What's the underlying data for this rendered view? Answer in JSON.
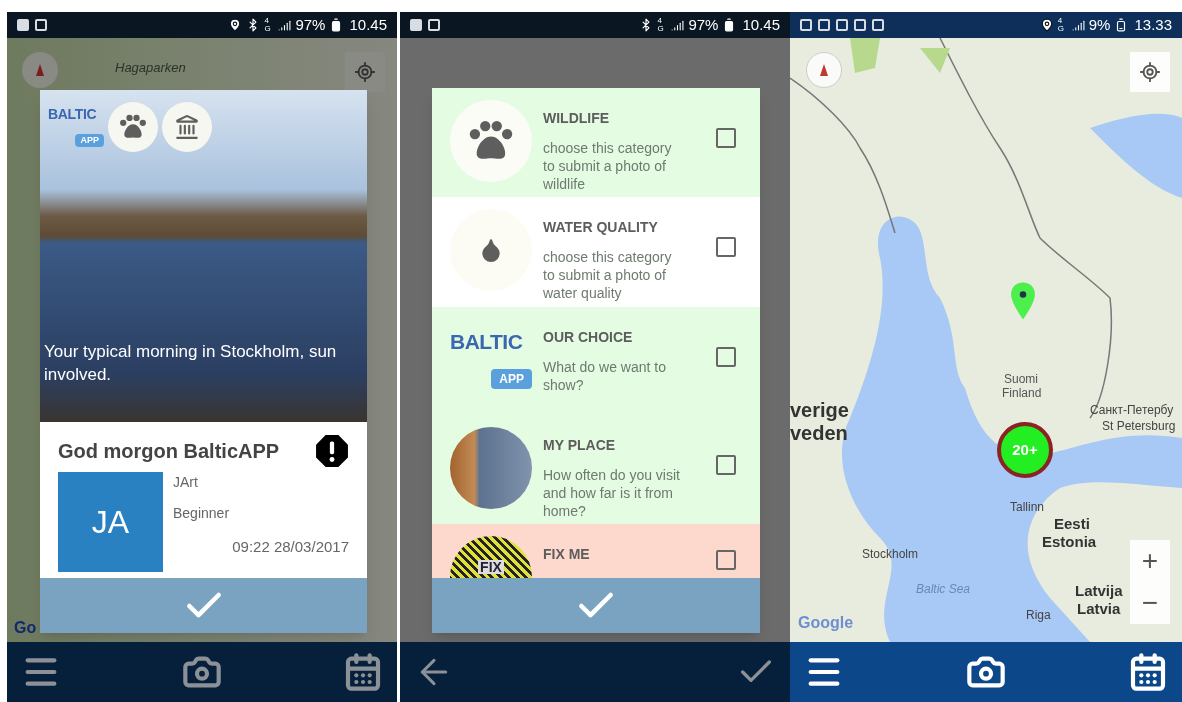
{
  "screens": [
    {
      "kind": "photo_card",
      "overlay": true,
      "status_bar": {
        "location_on": true,
        "bluetooth_on": true,
        "network": "4G",
        "battery": "97%",
        "time": "10.45"
      },
      "map_labels": [
        "Hagaparken",
        "Go"
      ],
      "card": {
        "logo": {
          "main": "BALTIC",
          "sub": "APP"
        },
        "caption": "Your typical morning in Stockholm, sun  involved.",
        "title": "God morgon BalticAPP",
        "avatar": "JA",
        "user": "JArt",
        "rank": "Beginner",
        "timestamp": "09:22 28/03/2017"
      },
      "nav": [
        {
          "kind": "menu"
        },
        {
          "kind": "camera"
        },
        {
          "kind": "calendar"
        }
      ]
    },
    {
      "kind": "category_list",
      "overlay": true,
      "status_bar": {
        "location_on": false,
        "bluetooth_on": true,
        "network": "4G",
        "battery": "97%",
        "time": "10.45"
      },
      "categories": [
        {
          "kind": "paw",
          "title": "WILDLIFE",
          "description": "choose this category to submit a photo of wildlife",
          "checked": false,
          "color": "#e3fce2"
        },
        {
          "kind": "drop",
          "title": "WATER QUALITY",
          "description": "choose this category to submit a photo of water quality",
          "checked": false,
          "color": "#ffffff"
        },
        {
          "kind": "logo",
          "logo": {
            "main": "BALTIC",
            "sub": "APP"
          },
          "title": "OUR CHOICE",
          "description": "What do we want to show?",
          "checked": false,
          "color": "#e3fce2"
        },
        {
          "kind": "photo",
          "title": "MY PLACE",
          "description": "How often do you visit and how far is it from home?",
          "checked": false,
          "color": "#e3fce2"
        },
        {
          "kind": "fixme",
          "icon_text": "FIX",
          "title": "FIX ME",
          "checked": false,
          "color": "#fdd8cd"
        }
      ],
      "nav": [
        {
          "kind": "back"
        },
        {
          "kind": "check"
        }
      ]
    },
    {
      "kind": "map",
      "overlay": false,
      "status_bar": {
        "location_on": true,
        "bluetooth_on": false,
        "network": "4G",
        "battery": "9%",
        "time": "13.33"
      },
      "map_labels": [
        "verige",
        "veden",
        "Suomi",
        "Finland",
        "Санкт-Петербу",
        "St Petersburg",
        "Tallinn",
        "Eesti",
        "Estonia",
        "Stockholm",
        "Baltic Sea",
        "Latvija",
        "Latvia",
        "Riga",
        "Google"
      ],
      "cluster": "20+",
      "zoom_in": "+",
      "zoom_out": "−",
      "nav": [
        {
          "kind": "menu"
        },
        {
          "kind": "camera"
        },
        {
          "kind": "calendar"
        }
      ]
    }
  ]
}
